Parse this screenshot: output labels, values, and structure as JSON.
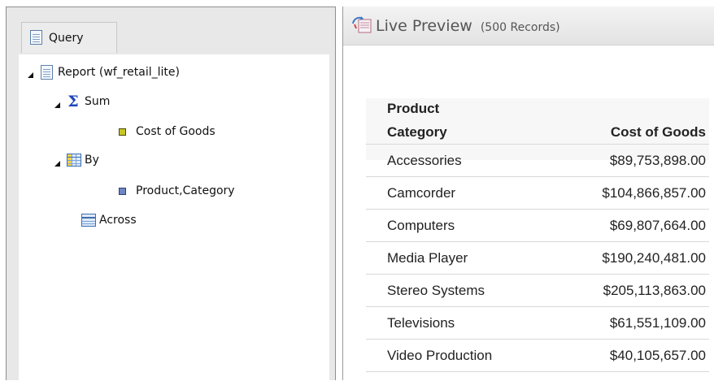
{
  "query_panel": {
    "tab_label": "Query",
    "tree": {
      "root": {
        "label": "Report (wf_retail_lite)",
        "icon": "report-doc-icon"
      },
      "sum": {
        "label": "Sum",
        "icon": "sigma-icon"
      },
      "sum_field": {
        "label": "Cost of Goods",
        "icon": "measure-field-icon"
      },
      "by": {
        "label": "By",
        "icon": "by-grid-icon"
      },
      "by_field": {
        "label": "Product,Category",
        "icon": "dimension-field-icon"
      },
      "across": {
        "label": "Across",
        "icon": "across-grid-icon"
      }
    }
  },
  "preview_panel": {
    "title": "Live Preview",
    "record_count": "(500 Records)",
    "table": {
      "headers": [
        "Product\nCategory",
        "Cost of Goods"
      ],
      "header_line1": "Product",
      "header_line2": "Category",
      "value_header": "Cost of Goods",
      "rows": [
        {
          "category": "Accessories",
          "cost": "$89,753,898.00"
        },
        {
          "category": "Camcorder",
          "cost": "$104,866,857.00"
        },
        {
          "category": "Computers",
          "cost": "$69,807,664.00"
        },
        {
          "category": "Media Player",
          "cost": "$190,240,481.00"
        },
        {
          "category": "Stereo Systems",
          "cost": "$205,113,863.00"
        },
        {
          "category": "Televisions",
          "cost": "$61,551,109.00"
        },
        {
          "category": "Video Production",
          "cost": "$40,105,657.00"
        }
      ]
    }
  }
}
